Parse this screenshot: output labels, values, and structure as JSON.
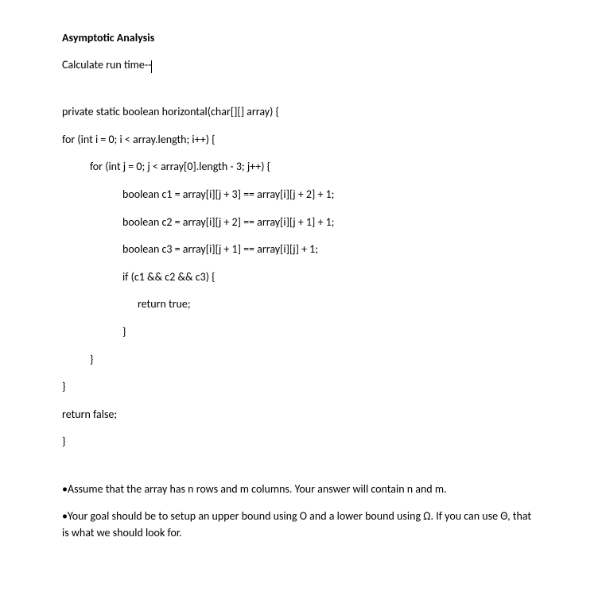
{
  "title": "Asymptotic Analysis",
  "subtitle": "Calculate run time--",
  "code": {
    "l1": "private static boolean horizontal(char[][] array) {",
    "l2": "for (int i = 0; i < array.length; i++) {",
    "l3": "           for (int j = 0; j < array[0].length - 3; j++) {",
    "l4": "                        boolean c1 = array[i][j + 3] == array[i][j + 2] + 1;",
    "l5": "                        boolean c2 = array[i][j + 2] == array[i][j + 1] + 1;",
    "l6": "                        boolean c3 = array[i][j + 1] == array[i][j] + 1;",
    "l7": "                        if (c1 && c2 && c3) {",
    "l8": "                              return true;",
    "l9": "                        }",
    "l10": "           }",
    "l11": "}",
    "l12": "return false;",
    "l13": "}"
  },
  "notes": {
    "n1": " •Assume that the array has n rows and m columns.  Your answer will contain n and m.",
    "n2": "•Your goal should be to setup an upper bound using O and a lower bound using Ω.  If you can use Θ, that is what we should look for."
  }
}
